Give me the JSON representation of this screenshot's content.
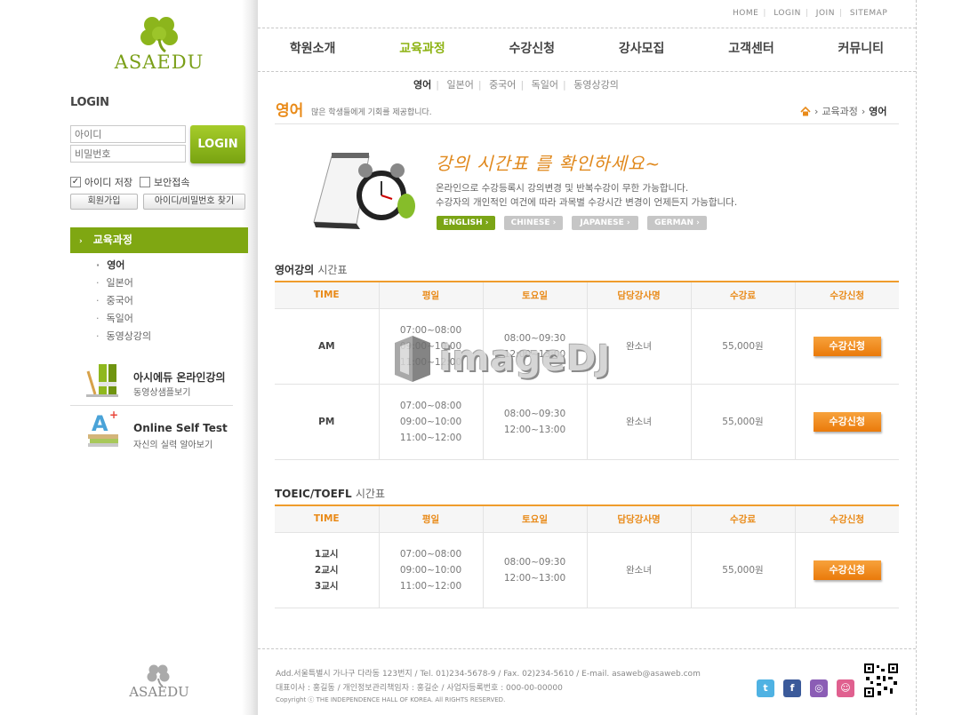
{
  "logo": {
    "text": "ASAEDU",
    "footer_text": "ASAEDU"
  },
  "top_links": [
    "HOME",
    "LOGIN",
    "JOIN",
    "SITEMAP"
  ],
  "gnb": [
    {
      "label": "학원소개",
      "active": false
    },
    {
      "label": "교육과정",
      "active": true
    },
    {
      "label": "수강신청",
      "active": false
    },
    {
      "label": "강사모집",
      "active": false
    },
    {
      "label": "고객센터",
      "active": false
    },
    {
      "label": "커뮤니티",
      "active": false
    }
  ],
  "subnav": [
    "영어",
    "일본어",
    "중국어",
    "독일어",
    "동영상강의"
  ],
  "login": {
    "heading": "LOGIN",
    "id_placeholder": "아이디",
    "pw_placeholder": "비밀번호",
    "button": "LOGIN",
    "save_id": "아이디 저장",
    "secure": "보안접속",
    "join": "회원가입",
    "find": "아이디/비밀번호 찾기"
  },
  "side_menu": {
    "header": "교육과정",
    "items": [
      "영어",
      "일본어",
      "중국어",
      "독일어",
      "동영상강의"
    ]
  },
  "side_banners": [
    {
      "title": "아시에듀 온라인강의",
      "sub": "동영상샘플보기"
    },
    {
      "title": "Online Self Test",
      "sub": "자신의 실력 알아보기"
    }
  ],
  "page": {
    "title": "영어",
    "desc": "많은 학생들에게 기회를 제공합니다.",
    "breadcrumb": [
      "교육과정",
      "영어"
    ]
  },
  "banner": {
    "title": "강의 시간표 를 확인하세요~",
    "line1": "온라인으로 수강등록시 강의변경 및 반복수강이 무한 가능합니다.",
    "line2": "수강자의 개인적인 여건에 따라 과목별 수강시간 변경이 언제든지 가능합니다.",
    "langs": [
      "ENGLISH",
      "CHINESE",
      "JAPANESE",
      "GERMAN"
    ]
  },
  "table1": {
    "title_strong": "영어강의",
    "title_light": "시간표",
    "headers": [
      "TIME",
      "평일",
      "토요일",
      "담당강사명",
      "수강료",
      "수강신청"
    ],
    "rows": [
      {
        "label": "AM",
        "weekday": [
          "07:00~08:00",
          "09:00~10:00",
          "11:00~12:00"
        ],
        "saturday": [
          "08:00~09:30",
          "12:00~13:00"
        ],
        "teacher": "완소녀",
        "fee": "55,000원",
        "apply": "수강신청"
      },
      {
        "label": "PM",
        "weekday": [
          "07:00~08:00",
          "09:00~10:00",
          "11:00~12:00"
        ],
        "saturday": [
          "08:00~09:30",
          "12:00~13:00"
        ],
        "teacher": "완소녀",
        "fee": "55,000원",
        "apply": "수강신청"
      }
    ]
  },
  "table2": {
    "title_strong": "TOEIC/TOEFL",
    "title_light": "시간표",
    "headers": [
      "TIME",
      "평일",
      "토요일",
      "담당강사명",
      "수강료",
      "수강신청"
    ],
    "rows": [
      {
        "label": [
          "1교시",
          "2교시",
          "3교시"
        ],
        "weekday": [
          "07:00~08:00",
          "09:00~10:00",
          "11:00~12:00"
        ],
        "saturday": [
          "08:00~09:30",
          "12:00~13:00"
        ],
        "teacher": "완소녀",
        "fee": "55,000원",
        "apply": "수강신청"
      }
    ]
  },
  "watermark": "imageDJ",
  "footer": {
    "address": "Add.서울특별시 가나구 다라동 123번지  / Tel. 01)234-5678-9  / Fax. 02)234-5610  / E-mail. asaweb@asaweb.com",
    "rep": "대표이사 : 홍길동 / 개인정보관리책임자 : 홍길순 / 사업자등록번호 : 000-00-00000",
    "copyright": "Copyright ⓒ THE INDEPENDENCE HALL OF KOREA. All RIGHTS RESERVED."
  },
  "colors": {
    "brand_green": "#7fa712",
    "accent_orange": "#e98a18"
  }
}
